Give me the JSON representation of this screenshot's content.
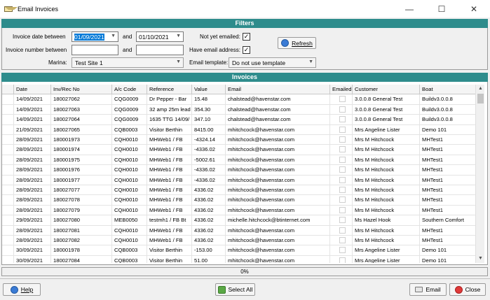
{
  "window": {
    "title": "Email Invoices"
  },
  "filters": {
    "header": "Filters",
    "invoice_date_between_label": "Invoice date between",
    "date_from": "01/09/2021",
    "date_to": "01/10/2021",
    "and_label": "and",
    "and_label2": "and",
    "invoice_number_between_label": "Invoice number between",
    "number_from": "",
    "number_to": "",
    "marina_label": "Marina:",
    "marina_value": "Test Site 1",
    "not_yet_emailed_label": "Not yet emailed:",
    "not_yet_emailed_checked": true,
    "have_email_address_label": "Have email address:",
    "have_email_address_checked": true,
    "email_template_label": "Email template:",
    "email_template_value": "Do not use template",
    "refresh_label": "Refresh"
  },
  "invoices": {
    "header": "Invoices",
    "columns": [
      "",
      "Date",
      "Inv/Rec No",
      "A/c Code",
      "Reference",
      "Value",
      "Email",
      "Emailed",
      "Customer",
      "Boat"
    ],
    "rows": [
      [
        "14/09/2021",
        "180027062",
        "CQG0009",
        "Dr Pepper - Bar",
        "15.48",
        "chalstead@havenstar.com",
        "3.0.0.8 General Test",
        "Buildv3.0.0.8"
      ],
      [
        "14/09/2021",
        "180027063",
        "CQG0009",
        "32 amp 25m lead",
        "354.30",
        "chalstead@havenstar.com",
        "3.0.0.8 General Test",
        "Buildv3.0.0.8"
      ],
      [
        "14/09/2021",
        "180027064",
        "CQG0009",
        "1635 TTG 14/09/",
        "347.10",
        "chalstead@havenstar.com",
        "3.0.0.8 General Test",
        "Buildv3.0.0.8"
      ],
      [
        "21/09/2021",
        "180027065",
        "CQB0003",
        "Visitor Berthin",
        "8415.00",
        "mhitchcock@havenstar.com",
        "Mrs Angeline Lister",
        "Demo 101"
      ],
      [
        "28/09/2021",
        "180001973",
        "CQH0010",
        "MHWeb1 / FB",
        "-4324.14",
        "mhitchcock@havenstar.com",
        "Mrs M Hitchcock",
        "MHTest1"
      ],
      [
        "28/09/2021",
        "180001974",
        "CQH0010",
        "MHWeb1 / FB",
        "-4336.02",
        "mhitchcock@havenstar.com",
        "Mrs M Hitchcock",
        "MHTest1"
      ],
      [
        "28/09/2021",
        "180001975",
        "CQH0010",
        "MHWeb1 / FB",
        "-5002.61",
        "mhitchcock@havenstar.com",
        "Mrs M Hitchcock",
        "MHTest1"
      ],
      [
        "28/09/2021",
        "180001976",
        "CQH0010",
        "MHWeb1 / FB",
        "-4336.02",
        "mhitchcock@havenstar.com",
        "Mrs M Hitchcock",
        "MHTest1"
      ],
      [
        "28/09/2021",
        "180001977",
        "CQH0010",
        "MHWeb1 / FB",
        "-4336.02",
        "mhitchcock@havenstar.com",
        "Mrs M Hitchcock",
        "MHTest1"
      ],
      [
        "28/09/2021",
        "180027077",
        "CQH0010",
        "MHWeb1 / FB",
        "4336.02",
        "mhitchcock@havenstar.com",
        "Mrs M Hitchcock",
        "MHTest1"
      ],
      [
        "28/09/2021",
        "180027078",
        "CQH0010",
        "MHWeb1 / FB",
        "4336.02",
        "mhitchcock@havenstar.com",
        "Mrs M Hitchcock",
        "MHTest1"
      ],
      [
        "28/09/2021",
        "180027079",
        "CQH0010",
        "MHWeb1 / FB",
        "4336.02",
        "mhitchcock@havenstar.com",
        "Mrs M Hitchcock",
        "MHTest1"
      ],
      [
        "29/09/2021",
        "180027080",
        "MEB0050",
        "testmh1 / FB Bt",
        "4336.02",
        "michelle.hitchcock@btinternet.com",
        "Ms Hazel Hook",
        "Southern Comfort"
      ],
      [
        "28/09/2021",
        "180027081",
        "CQH0010",
        "MHWeb1 / FB",
        "4336.02",
        "mhitchcock@havenstar.com",
        "Mrs M Hitchcock",
        "MHTest1"
      ],
      [
        "28/09/2021",
        "180027082",
        "CQH0010",
        "MHWeb1 / FB",
        "4336.02",
        "mhitchcock@havenstar.com",
        "Mrs M Hitchcock",
        "MHTest1"
      ],
      [
        "30/09/2021",
        "180001978",
        "CQB0003",
        "Visitor Berthin",
        "-153.00",
        "mhitchcock@havenstar.com",
        "Mrs Angeline Lister",
        "Demo 101"
      ],
      [
        "30/09/2021",
        "180027084",
        "CQB0003",
        "Visitor Berthin",
        "51.00",
        "mhitchcock@havenstar.com",
        "Mrs Angeline Lister",
        "Demo 101"
      ]
    ]
  },
  "progress": {
    "text": "0%",
    "value": 0
  },
  "buttons": {
    "help": "Help",
    "select_all": "Select All",
    "email": "Email",
    "close": "Close"
  },
  "colors": {
    "section_header": "#2e8c8c",
    "selection": "#0078d7"
  }
}
